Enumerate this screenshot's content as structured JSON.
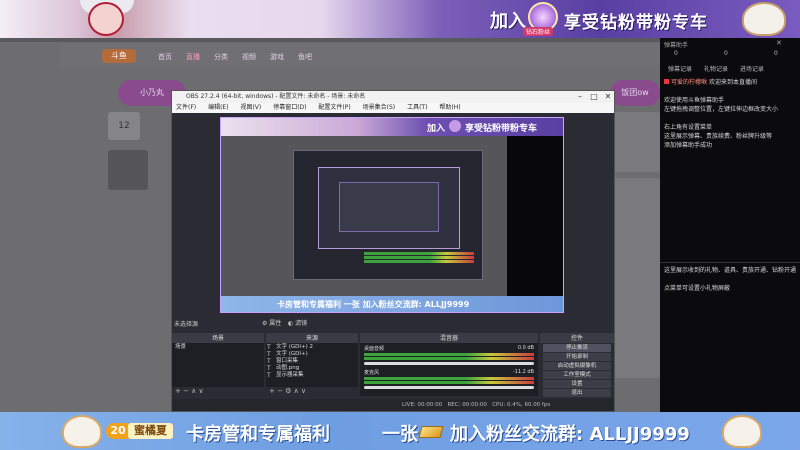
{
  "top_banner": {
    "join": "加入",
    "crest_tag": "钻石粉丝",
    "slogan": "享受钻粉带粉专车"
  },
  "website": {
    "logo": "斗鱼",
    "nav": [
      "首页",
      "直播",
      "分类",
      "视频",
      "游戏",
      "鱼吧"
    ],
    "pill_left": "小乃丸",
    "pill_right": "饭团ow",
    "fans_count": "12"
  },
  "chat_panel": {
    "header": "弹幕助手",
    "stats": [
      "0",
      "0",
      "0"
    ],
    "tabs": [
      "弹幕记录",
      "礼物记录",
      "进场记录"
    ],
    "highlight": "可爱的柠檬啾",
    "highlight_msg": "欢迎来到本直播间",
    "lines": [
      "欢迎使用斗鱼弹幕助手",
      "左键拖拽调整位置，左键拉伸边框改变大小",
      "右上角有设置菜单",
      "这里展示弹幕、贵族续费、粉丝牌升级等",
      "添加弹幕助手成功"
    ],
    "lines2": [
      "这里展示收到的礼物、道具、贵族开通、钻粉开通",
      "点菜单可设置小礼物屏蔽"
    ]
  },
  "obs": {
    "title": "OBS 27.2.4 (64-bit, windows) - 配置文件: 未命名 - 场景: 未命名",
    "menu": [
      "文件(F)",
      "编辑(E)",
      "视图(V)",
      "停靠窗口(D)",
      "配置文件(P)",
      "场景集合(S)",
      "工具(T)",
      "帮助(H)"
    ],
    "no_source": "未选择源",
    "props_btn": "属性",
    "filter_btn": "滤镜",
    "scenes_title": "场景",
    "scenes": [
      "场景"
    ],
    "sources_title": "来源",
    "sources": [
      "文字 (GDI+) 2",
      "文字 (GDI+)",
      "窗口采集",
      "动图.png",
      "显示器采集"
    ],
    "mixer_title": "混音器",
    "mixer": [
      {
        "name": "桌面音频",
        "db": "0.0 dB"
      },
      {
        "name": "麦克风",
        "db": "-11.2 dB"
      }
    ],
    "controls_title": "控件",
    "controls": [
      "停止推流",
      "开始录制",
      "启动虚拟摄像机",
      "工作室模式",
      "设置",
      "退出"
    ],
    "status": {
      "live": "LIVE: 00:00:00",
      "rec": "REC: 00:00:00",
      "cpu": "CPU: 0.4%, 60.00 fps"
    },
    "preview_join": "加入",
    "preview_slogan": "享受钻粉带粉专车",
    "preview_bottom": "卡房管和专属福利   一张   加入粉丝交流群: ALLJJ9999"
  },
  "bottom_banner": {
    "level": "20",
    "name": "蜜橘夏",
    "text1": "卡房管和专属福利",
    "text2": "一张",
    "text3": "加入粉丝交流群: ALLJJ9999"
  }
}
